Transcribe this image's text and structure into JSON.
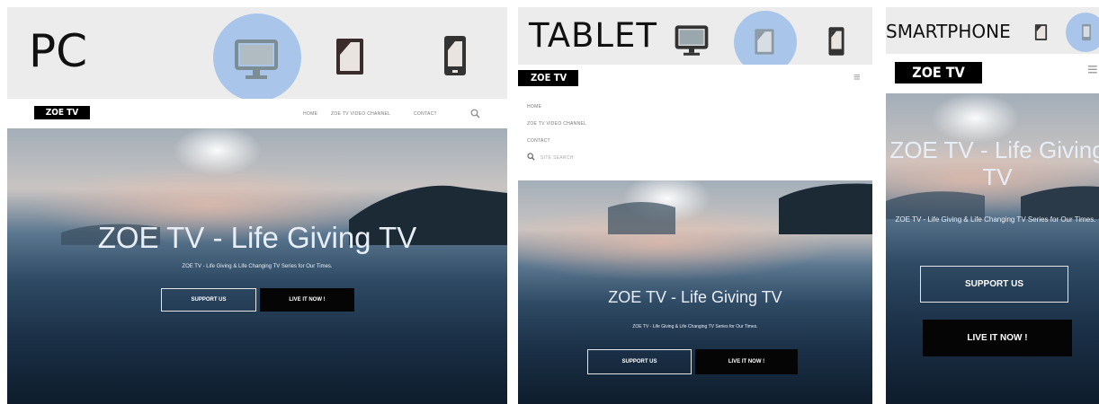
{
  "pc": {
    "device_label": "PC",
    "site": {
      "logo": "ZOE TV",
      "nav": [
        "HOME",
        "ZOE TV VIDEO CHANNEL",
        "CONTACT"
      ],
      "hero_title": "ZOE TV - Life Giving TV",
      "hero_subtitle": "ZOE TV - Life Giving & Life Changing TV Series for Our Times.",
      "btn_support": "SUPPORT US",
      "btn_live": "LIVE IT NOW !"
    }
  },
  "tablet": {
    "device_label": "TABLET",
    "site": {
      "logo": "ZOE TV",
      "menu": [
        "HOME",
        "ZOE TV VIDEO CHANNEL",
        "CONTACT"
      ],
      "search_placeholder": "SITE SEARCH",
      "hero_title": "ZOE TV - Life Giving TV",
      "hero_subtitle": "ZOE TV - Life Giving & Life Changing TV Series for Our Times.",
      "btn_support": "SUPPORT US",
      "btn_live": "LIVE IT NOW !"
    }
  },
  "smartphone": {
    "device_label": "SMARTPHONE",
    "site": {
      "logo": "ZOE TV",
      "hero_title": "ZOE TV - Life Giving TV",
      "hero_subtitle": "ZOE TV - Life Giving & Life Changing TV Series for Our Times.",
      "btn_support": "SUPPORT US",
      "btn_live": "LIVE IT NOW !"
    }
  },
  "icons": [
    "monitor-icon",
    "tablet-icon",
    "smartphone-icon",
    "search-icon",
    "hamburger-menu-icon"
  ],
  "colors": {
    "active_circle": "#a9c6ea",
    "device_bar": "#ececec",
    "logo_bg": "#000000"
  }
}
